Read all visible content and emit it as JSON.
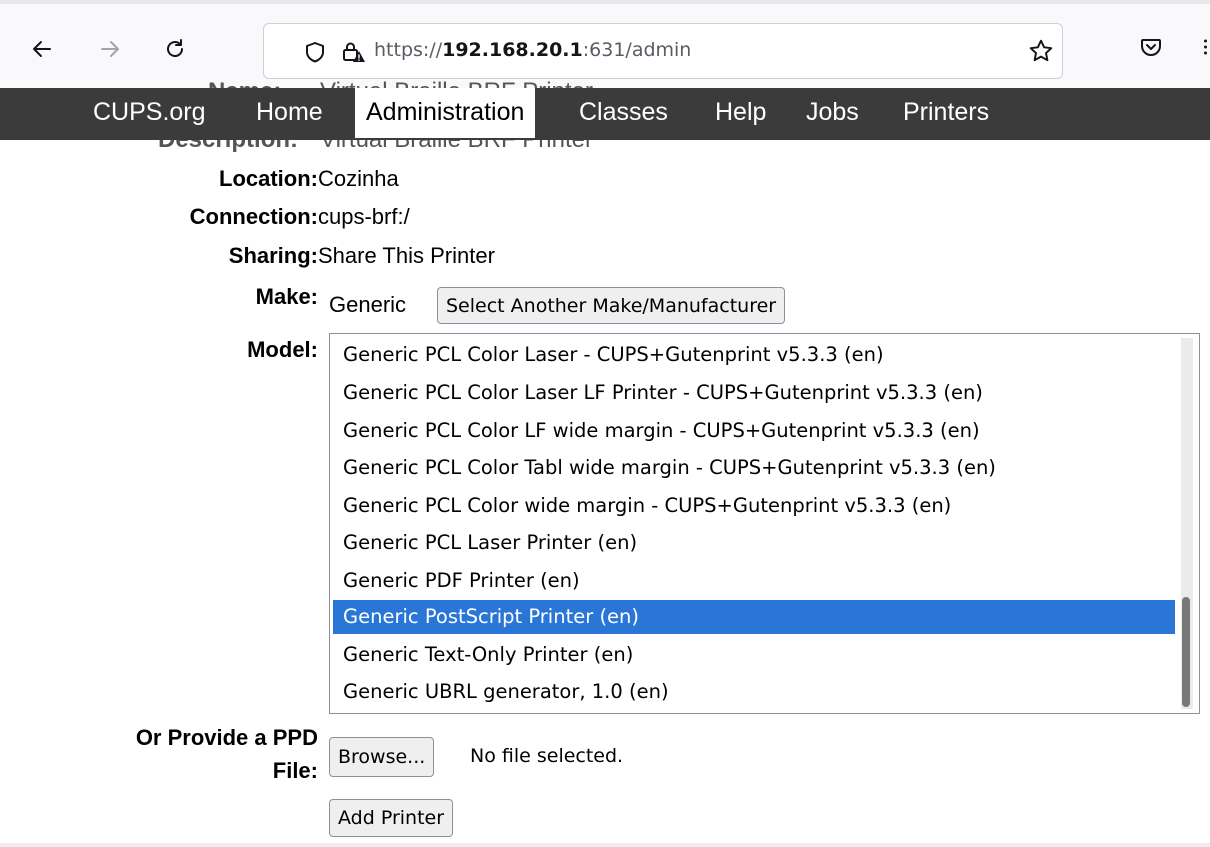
{
  "browser": {
    "url_scheme": "https://",
    "url_host": "192.168.20.1",
    "url_rest": ":631/admin",
    "icons": {
      "back": "arrow-left-icon",
      "forward": "arrow-right-icon",
      "reload": "reload-icon",
      "tracking": "shield-icon",
      "security": "lock-warning-icon",
      "bookmark": "star-icon",
      "pocket": "pocket-icon"
    }
  },
  "nav": {
    "items": [
      "CUPS.org",
      "Home",
      "Administration",
      "Classes",
      "Help",
      "Jobs",
      "Printers"
    ],
    "active": "Administration",
    "background_color": "#3b3b3b"
  },
  "hidden_behind_nav": {
    "name_label": "Name:",
    "name_value": "Virtual Braille BRF Printer",
    "description_label": "Description:",
    "description_value": "Virtual Braille BRF Printer"
  },
  "form": {
    "location_label": "Location:",
    "location_value": "Cozinha",
    "connection_label": "Connection:",
    "connection_value": "cups-brf:/",
    "sharing_label": "Sharing:",
    "sharing_value": "Share This Printer",
    "make_label": "Make:",
    "make_value": "Generic",
    "make_button": "Select Another Make/Manufacturer",
    "model_label": "Model:",
    "model_options": [
      "Generic PCL Color Laser - CUPS+Gutenprint v5.3.3 (en)",
      "Generic PCL Color Laser LF Printer - CUPS+Gutenprint v5.3.3 (en)",
      "Generic PCL Color LF wide margin - CUPS+Gutenprint v5.3.3 (en)",
      "Generic PCL Color Tabl wide margin - CUPS+Gutenprint v5.3.3 (en)",
      "Generic PCL Color wide margin - CUPS+Gutenprint v5.3.3 (en)",
      "Generic PCL Laser Printer (en)",
      "Generic PDF Printer (en)",
      "Generic PostScript Printer (en)",
      "Generic Text-Only Printer (en)",
      "Generic UBRL generator, 1.0 (en)"
    ],
    "model_selected": "Generic PostScript Printer (en)",
    "selection_color": "#2a76d6",
    "ppd_label_line1": "Or Provide a PPD",
    "ppd_label_line2": "File:",
    "browse_button": "Browse...",
    "file_status": "No file selected.",
    "add_button": "Add Printer"
  }
}
